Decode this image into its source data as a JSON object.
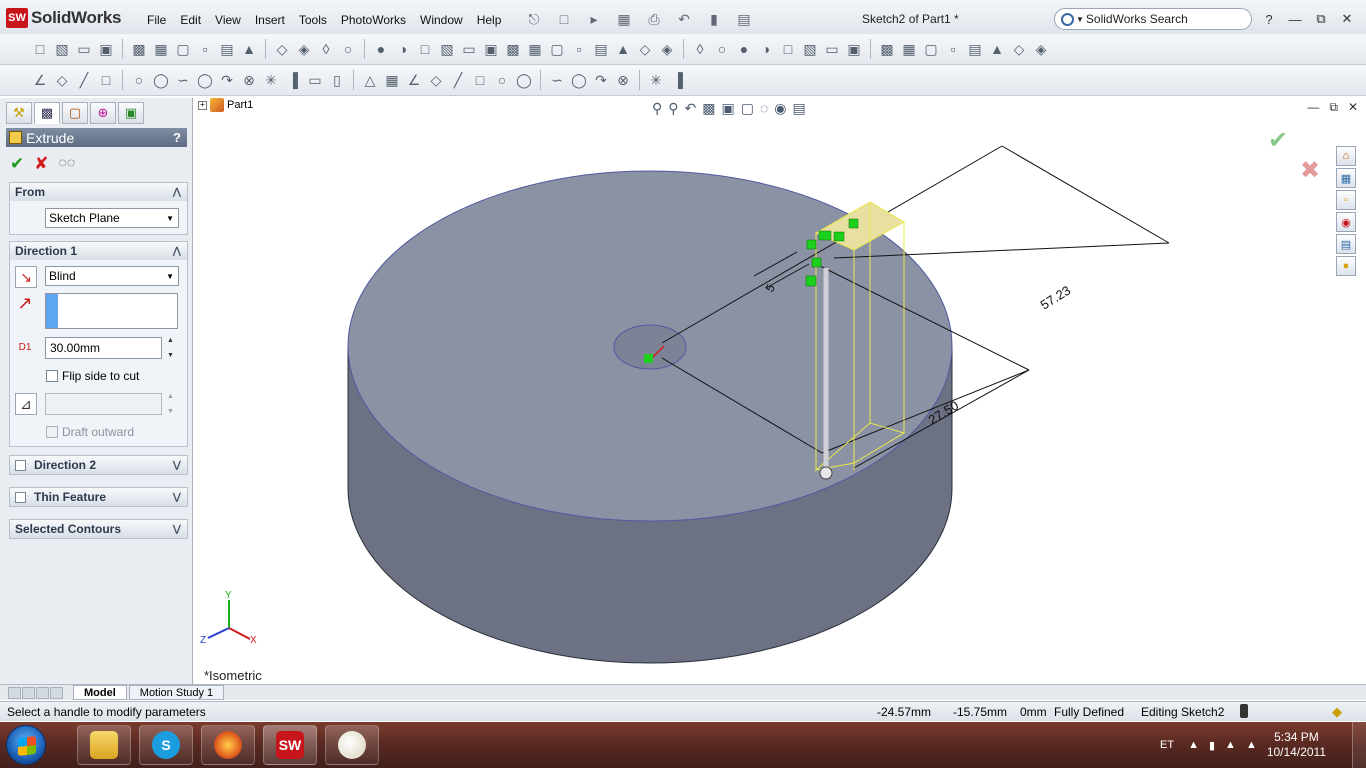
{
  "app": {
    "logo_text": "SolidWorks",
    "logo_badge": "SW",
    "document_title": "Sketch2 of Part1 *",
    "search_placeholder": "SolidWorks Search",
    "help_label": "?"
  },
  "menu": [
    "File",
    "Edit",
    "View",
    "Insert",
    "Tools",
    "PhotoWorks",
    "Window",
    "Help"
  ],
  "left_panel": {
    "header": "Extrude",
    "help": "?",
    "from_group": {
      "title": "From",
      "option": "Sketch Plane"
    },
    "direction1": {
      "title": "Direction 1",
      "end_condition": "Blind",
      "depth_value": "30.00mm",
      "depth_label": "D1",
      "flip_side_label": "Flip side to cut",
      "draft_outward_label": "Draft outward"
    },
    "collapsed_groups": {
      "direction2": "Direction 2",
      "thin_feature": "Thin Feature",
      "selected_contours": "Selected Contours"
    }
  },
  "feature_tree": {
    "root": "Part1"
  },
  "viewport": {
    "view_name": "*Isometric",
    "axes": {
      "x": "X",
      "y": "Y",
      "z": "Z"
    },
    "dimensions": [
      "57.23",
      "27.50",
      "5"
    ]
  },
  "bottom_tabs": [
    "Model",
    "Motion Study 1"
  ],
  "status_bar": {
    "message": "Select a handle to modify parameters",
    "x_coord": "-24.57mm",
    "y_coord": "-15.75mm",
    "z_coord": "0mm",
    "sketch_state": "Fully Defined",
    "editing": "Editing Sketch2"
  },
  "taskbar": {
    "language": "ET",
    "time": "5:34 PM",
    "date": "10/14/2011",
    "apps": [
      "windows-explorer",
      "skype",
      "firefox",
      "solidworks",
      "paint"
    ]
  },
  "colors": {
    "body_top": "#8b92a4",
    "body_side": "#6c7284",
    "sketch_yellow": "#e8e84a",
    "sketch_green": "#1bd11b",
    "accent_red": "#c8151b"
  }
}
